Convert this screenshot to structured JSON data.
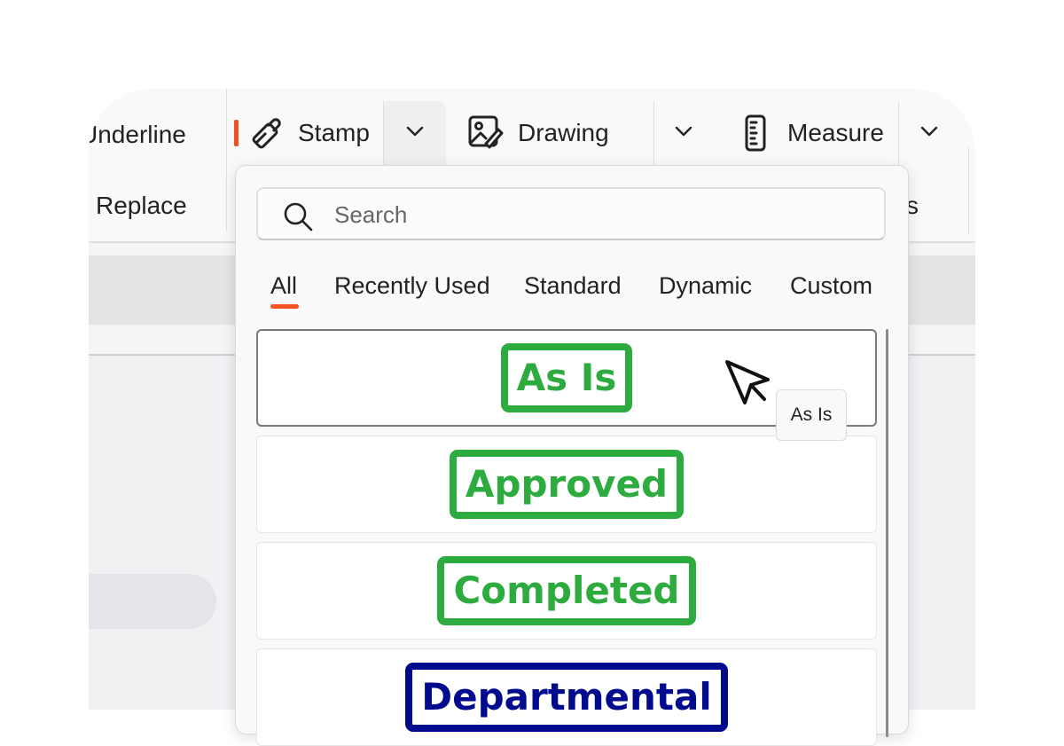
{
  "toolbar": {
    "underline_label": "Underline",
    "replace_label": "Replace",
    "stamp_label": "Stamp",
    "drawing_label": "Drawing",
    "measure_label": "Measure",
    "partial_label": "s"
  },
  "dropdown": {
    "search_placeholder": "Search",
    "tabs": [
      {
        "label": "All",
        "active": true
      },
      {
        "label": "Recently Used",
        "active": false
      },
      {
        "label": "Standard",
        "active": false
      },
      {
        "label": "Dynamic",
        "active": false
      },
      {
        "label": "Custom",
        "active": false
      }
    ],
    "stamps": [
      {
        "label": "As Is",
        "color": "#2eab3f",
        "selected": true
      },
      {
        "label": "Approved",
        "color": "#2eab3f",
        "selected": false
      },
      {
        "label": "Completed",
        "color": "#2eab3f",
        "selected": false
      },
      {
        "label": "Departmental",
        "color": "#000a8c",
        "selected": false
      }
    ]
  },
  "tooltip": {
    "text": "As Is"
  },
  "colors": {
    "accent": "#f4511e",
    "stamp_green": "#2eab3f",
    "stamp_blue": "#000a8c"
  },
  "icons": [
    "stamp-icon",
    "drawing-icon",
    "measure-icon",
    "chevron-down-icon",
    "search-icon",
    "mouse-cursor-icon"
  ]
}
